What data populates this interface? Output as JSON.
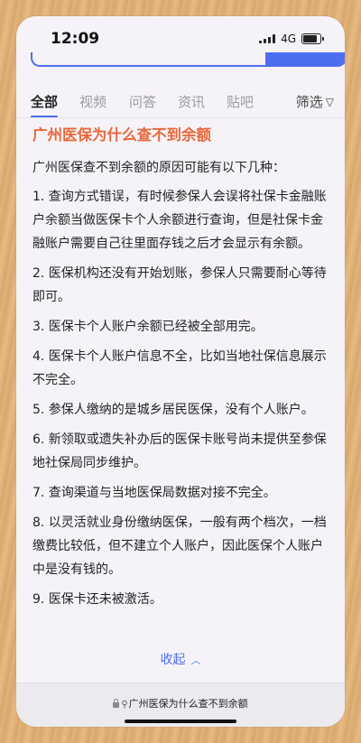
{
  "status_bar": {
    "time": "12:09",
    "network": "4G"
  },
  "tabs": [
    {
      "label": "全部",
      "active": true
    },
    {
      "label": "视频"
    },
    {
      "label": "问答"
    },
    {
      "label": "资讯"
    },
    {
      "label": "贴吧"
    }
  ],
  "filter_label": "筛选",
  "article": {
    "title": "广州医保为什么查不到余额",
    "intro": "广州医保查不到余额的原因可能有以下几种：",
    "items": [
      "1. 查询方式错误，有时候参保人会误将社保卡金融账户余额当做医保卡个人余额进行查询，但是社保卡金融账户需要自己往里面存钱之后才会显示有余额。",
      "2. 医保机构还没有开始划账，参保人只需要耐心等待即可。",
      "3. 医保卡个人账户余额已经被全部用完。",
      "4. 医保卡个人账户信息不全，比如当地社保信息展示不完全。",
      "5. 参保人缴纳的是城乡居民医保，没有个人账户。",
      "6. 新领取或遗失补办后的医保卡账号尚未提供至参保地社保局同步维护。",
      "7. 查询渠道与当地医保局数据对接不完全。",
      "8. 以灵活就业身份缴纳医保，一般有两个档次，一档缴费比较低，但不建立个人账户，因此医保个人账户中是没有钱的。",
      "9. 医保卡还未被激活。"
    ]
  },
  "collapse_label": "收起",
  "address_bar": {
    "query": "广州医保为什么查不到余额"
  },
  "colors": {
    "accent": "#4e6ef2",
    "title": "#e8683a"
  }
}
